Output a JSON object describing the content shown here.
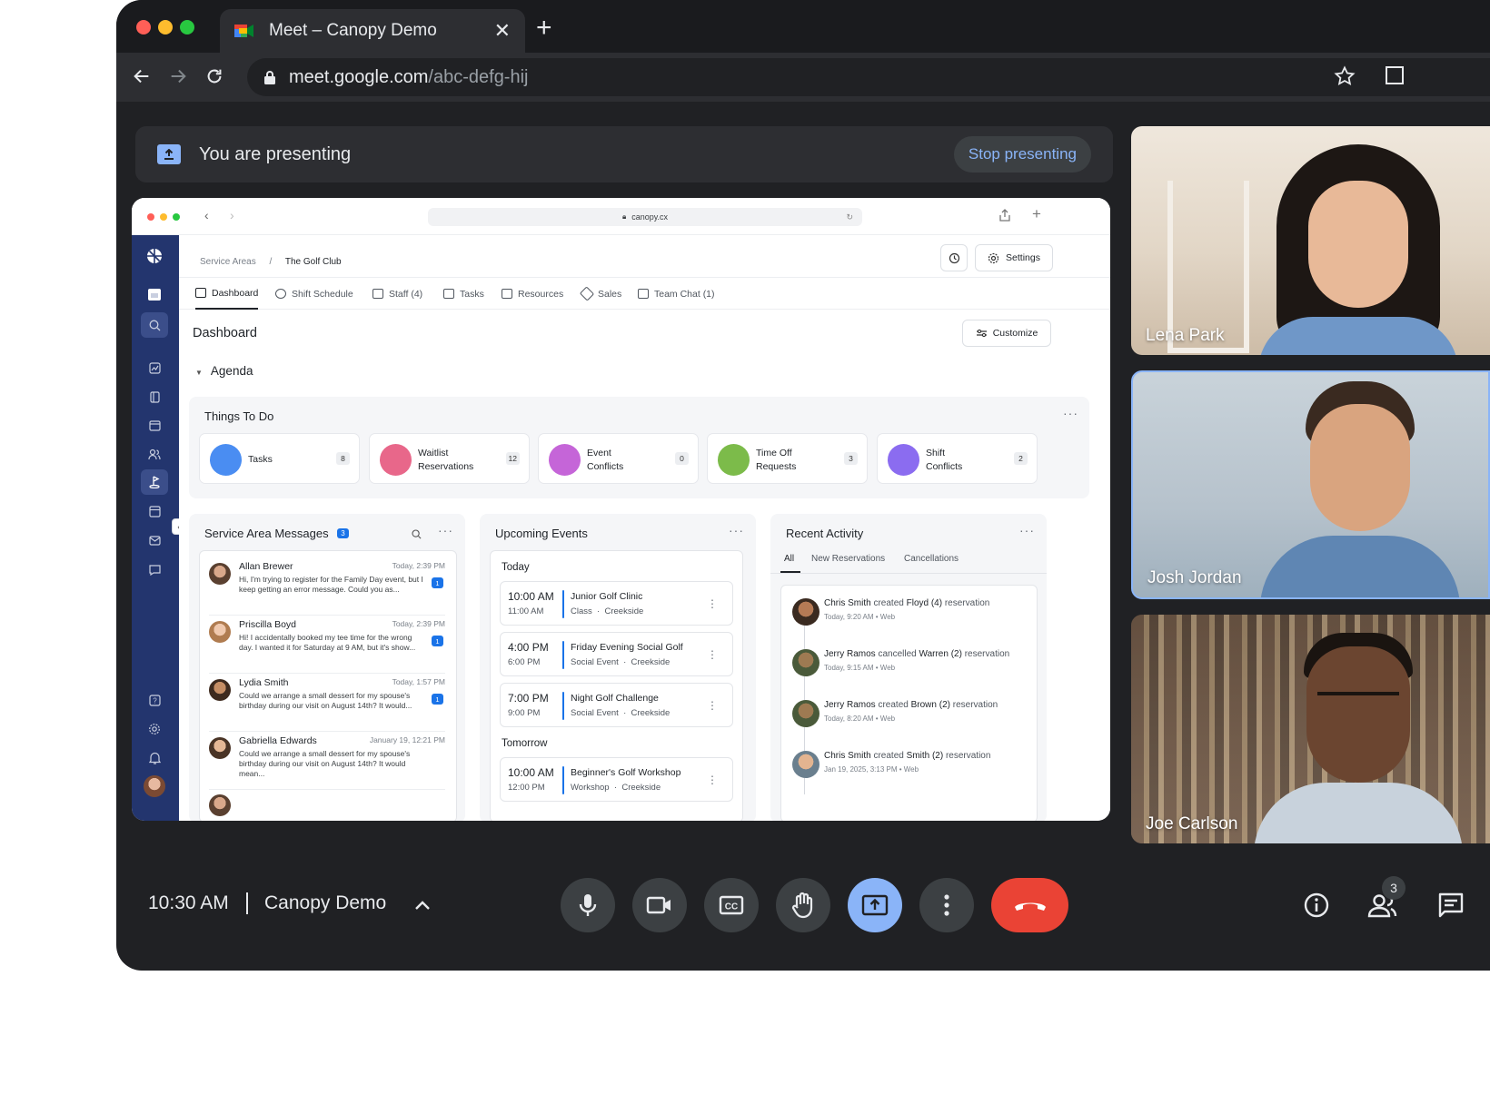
{
  "browser": {
    "tab_title": "Meet – Canopy Demo",
    "url_host": "meet.google.com",
    "url_path": "/abc-defg-hij"
  },
  "presenting": {
    "message": "You are presenting",
    "stop_label": "Stop presenting"
  },
  "shared_screen": {
    "url": "canopy.cx",
    "breadcrumb": {
      "parent": "Service Areas",
      "separator": "/",
      "current": "The Golf Club"
    },
    "settings_label": "Settings",
    "tabs": [
      {
        "label": "Dashboard"
      },
      {
        "label": "Shift Schedule"
      },
      {
        "label": "Staff (4)"
      },
      {
        "label": "Tasks"
      },
      {
        "label": "Resources"
      },
      {
        "label": "Sales"
      },
      {
        "label": "Team Chat (1)"
      }
    ],
    "page_title": "Dashboard",
    "customize_label": "Customize",
    "agenda_label": "Agenda",
    "things_to_do": {
      "title": "Things To Do",
      "cards": [
        {
          "line1": "Tasks",
          "line2": "",
          "count": "8",
          "color": "#4a8df2"
        },
        {
          "line1": "Waitlist",
          "line2": "Reservations",
          "count": "12",
          "color": "#e8678a"
        },
        {
          "line1": "Event",
          "line2": "Conflicts",
          "count": "0",
          "color": "#c565d8"
        },
        {
          "line1": "Time Off",
          "line2": "Requests",
          "count": "3",
          "color": "#7cbb4a"
        },
        {
          "line1": "Shift",
          "line2": "Conflicts",
          "count": "2",
          "color": "#8b6cf0"
        }
      ]
    },
    "messages": {
      "title": "Service Area Messages",
      "count": "3",
      "items": [
        {
          "name": "Allan Brewer",
          "time": "Today, 2:39 PM",
          "body": "Hi, I'm trying to register for the Family Day event, but I keep getting an error message. Could you as...",
          "badge": "1"
        },
        {
          "name": "Priscilla Boyd",
          "time": "Today, 2:39 PM",
          "body": "Hi! I accidentally booked my tee time for the wrong day. I wanted it for Saturday at 9 AM, but it's show...",
          "badge": "1"
        },
        {
          "name": "Lydia Smith",
          "time": "Today, 1:57 PM",
          "body": "Could we arrange a small dessert for my spouse's birthday during our visit on August 14th? It would...",
          "badge": "1"
        },
        {
          "name": "Gabriella Edwards",
          "time": "January 19, 12:21 PM",
          "body": "Could we arrange a small dessert for my spouse's birthday during our visit on August 14th? It would mean...",
          "badge": ""
        }
      ]
    },
    "events": {
      "title": "Upcoming Events",
      "today_label": "Today",
      "tomorrow_label": "Tomorrow",
      "today": [
        {
          "start": "10:00 AM",
          "end": "11:00 AM",
          "name": "Junior Golf Clinic",
          "type": "Class",
          "location": "Creekside"
        },
        {
          "start": "4:00 PM",
          "end": "6:00 PM",
          "name": "Friday Evening Social Golf",
          "type": "Social Event",
          "location": "Creekside"
        },
        {
          "start": "7:00 PM",
          "end": "9:00 PM",
          "name": "Night Golf Challenge",
          "type": "Social Event",
          "location": "Creekside"
        }
      ],
      "tomorrow": [
        {
          "start": "10:00 AM",
          "end": "12:00 PM",
          "name": "Beginner's Golf Workshop",
          "type": "Workshop",
          "location": "Creekside"
        }
      ]
    },
    "activity": {
      "title": "Recent Activity",
      "tabs": [
        "All",
        "New Reservations",
        "Cancellations"
      ],
      "items": [
        {
          "actor": "Chris Smith",
          "verb": "created",
          "target": "Floyd (4)",
          "suffix": "reservation",
          "meta": "Today, 9:20 AM • Web"
        },
        {
          "actor": "Jerry Ramos",
          "verb": "cancelled",
          "target": "Warren (2)",
          "suffix": "reservation",
          "meta": "Today, 9:15 AM • Web"
        },
        {
          "actor": "Jerry Ramos",
          "verb": "created",
          "target": "Brown (2)",
          "suffix": "reservation",
          "meta": "Today, 8:20 AM • Web"
        },
        {
          "actor": "Chris Smith",
          "verb": "created",
          "target": "Smith (2)",
          "suffix": "reservation",
          "meta": "Jan 19, 2025, 3:13 PM • Web"
        }
      ]
    }
  },
  "participants": [
    {
      "name": "Lena Park"
    },
    {
      "name": "Josh Jordan"
    },
    {
      "name": "Joe Carlson"
    }
  ],
  "controls": {
    "time": "10:30 AM",
    "meeting_name": "Canopy Demo",
    "people_count": "3"
  },
  "colors": {
    "accent": "#8ab4f8",
    "end_call": "#ea4335",
    "sidebar": "#23356e",
    "link_blue": "#1a73e8"
  }
}
